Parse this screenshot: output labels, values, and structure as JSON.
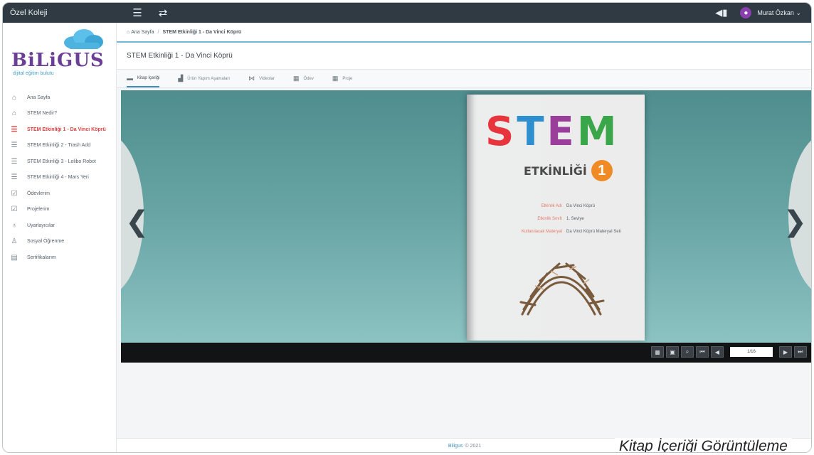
{
  "topbar": {
    "school": "Özel Koleji",
    "user": "Murat Özkan"
  },
  "logo": {
    "brand": "BiLiGUS",
    "tagline": "dijital eğitim bulutu"
  },
  "sidebar": {
    "items": [
      {
        "label": "Ana Sayfa",
        "icon": "home-icon",
        "active": false
      },
      {
        "label": "STEM Nedir?",
        "icon": "home-icon",
        "active": false
      },
      {
        "label": "STEM Etkinliği 1 - Da Vinci Köprü",
        "icon": "list-icon",
        "active": true
      },
      {
        "label": "STEM Etkinliği 2 - Trash Add",
        "icon": "list-icon",
        "active": false
      },
      {
        "label": "STEM Etkinliği 3 - Lolibo Robot",
        "icon": "list-icon",
        "active": false
      },
      {
        "label": "STEM Etkinliği 4 - Mars Yeri",
        "icon": "list-icon",
        "active": false
      },
      {
        "label": "Ödevlerim",
        "icon": "homework-icon",
        "active": false
      },
      {
        "label": "Projelerim",
        "icon": "project-icon",
        "active": false
      },
      {
        "label": "Uyarlayıcılar",
        "icon": "pin-icon",
        "active": false
      },
      {
        "label": "Sosyal Öğrenme",
        "icon": "people-icon",
        "active": false
      },
      {
        "label": "Sertifikalarım",
        "icon": "certificate-icon",
        "active": false
      }
    ]
  },
  "breadcrumb": {
    "home": "Ana Sayfa",
    "separator": "/",
    "current": "STEM Etkinliği 1 - Da Vinci Köprü"
  },
  "page": {
    "title": "STEM Etkinliği 1 - Da Vinci Köprü"
  },
  "tabs": [
    {
      "label": "Kitap İçeriği",
      "icon": "book-icon",
      "active": true
    },
    {
      "label": "Ürün Yapım Aşamaları",
      "icon": "chart-icon",
      "active": false
    },
    {
      "label": "Videolar",
      "icon": "video-icon",
      "active": false
    },
    {
      "label": "Ödev",
      "icon": "calendar-icon",
      "active": false
    },
    {
      "label": "Proje",
      "icon": "calendar-icon",
      "active": false
    }
  ],
  "book": {
    "stem_letters": [
      "S",
      "T",
      "E",
      "M"
    ],
    "subtitle": "ETKİNLİĞİ",
    "number": "1",
    "meta": [
      {
        "key": "Etkinlik Adı",
        "value": "Da Vinci Köprü"
      },
      {
        "key": "Etkinlik Sınıfı",
        "value": "1. Seviye"
      },
      {
        "key": "Kullanılacak Materyal",
        "value": "Da Vinci Köprü Materyal Seti"
      }
    ]
  },
  "viewer": {
    "page_indicator": "1/16"
  },
  "footer": {
    "brand": "Biligus",
    "copyright": "© 2021"
  },
  "caption": "Kitap İçeriği Görüntüleme"
}
